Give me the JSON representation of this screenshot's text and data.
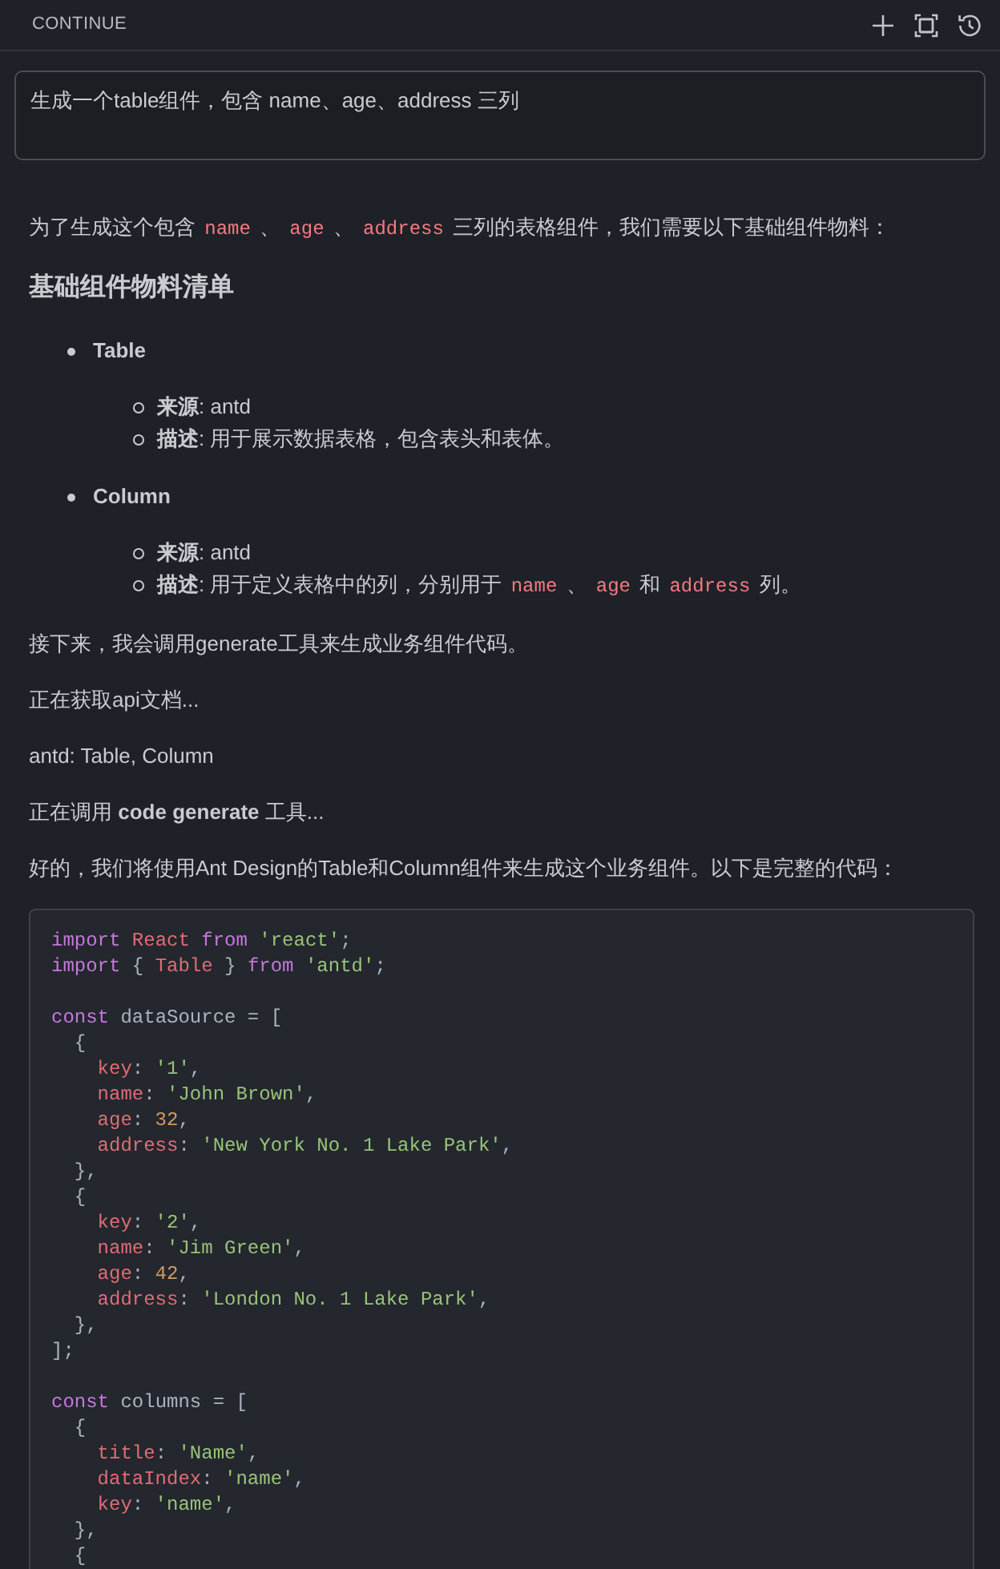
{
  "header": {
    "title": "CONTINUE"
  },
  "prompt": {
    "value": "生成一个table组件，包含 name、age、address 三列"
  },
  "message": [
    {
      "kind": "paragraph",
      "segments": [
        {
          "kind": "text",
          "text": "为了生成这个包含 "
        },
        {
          "kind": "code",
          "text": "name"
        },
        {
          "kind": "text",
          "text": " 、 "
        },
        {
          "kind": "code",
          "text": "age"
        },
        {
          "kind": "text",
          "text": " 、 "
        },
        {
          "kind": "code",
          "text": "address"
        },
        {
          "kind": "text",
          "text": " 三列的表格组件，我们需要以下基础组件物料："
        }
      ]
    },
    {
      "kind": "heading",
      "text": "基础组件物料清单"
    },
    {
      "kind": "list",
      "items": [
        {
          "text": "Table",
          "children": [
            {
              "segments": [
                {
                  "kind": "text",
                  "text": "**来源**: antd"
                }
              ]
            },
            {
              "segments": [
                {
                  "kind": "text",
                  "text": "**描述**: 用于展示数据表格，包含表头和表体。"
                }
              ]
            }
          ]
        },
        {
          "text": "Column",
          "children": [
            {
              "segments": [
                {
                  "kind": "text",
                  "text": "**来源**: antd"
                }
              ]
            },
            {
              "segments": [
                {
                  "kind": "text",
                  "text": "**描述**: 用于定义表格中的列，分别用于 "
                },
                {
                  "kind": "code",
                  "text": "name"
                },
                {
                  "kind": "text",
                  "text": " 、 "
                },
                {
                  "kind": "code",
                  "text": "age"
                },
                {
                  "kind": "text",
                  "text": " 和 "
                },
                {
                  "kind": "code",
                  "text": "address"
                },
                {
                  "kind": "text",
                  "text": " 列。"
                }
              ]
            }
          ]
        }
      ]
    },
    {
      "kind": "paragraph",
      "segments": [
        {
          "kind": "text",
          "text": "接下来，我会调用generate工具来生成业务组件代码。"
        }
      ]
    },
    {
      "kind": "paragraph",
      "segments": [
        {
          "kind": "text",
          "text": "正在获取api文档..."
        }
      ]
    },
    {
      "kind": "paragraph",
      "segments": [
        {
          "kind": "text",
          "text": "antd: Table, Column"
        }
      ]
    },
    {
      "kind": "paragraph",
      "segments": [
        {
          "kind": "text",
          "text": "正在调用 **code generate** 工具..."
        }
      ]
    },
    {
      "kind": "paragraph",
      "segments": [
        {
          "kind": "text",
          "text": "好的，我们将使用Ant Design的Table和Column组件来生成这个业务组件。以下是完整的代码："
        }
      ]
    },
    {
      "kind": "code",
      "groups": [
        [
          {
            "tokens": [
              {
                "kind": "keyword",
                "text": "import"
              },
              {
                "kind": "name",
                "text": " React"
              },
              {
                "kind": "keyword",
                "text": " from"
              },
              {
                "kind": "string",
                "text": " 'react'"
              },
              {
                "kind": "plain",
                "text": ";"
              }
            ]
          },
          {
            "tokens": [
              {
                "kind": "keyword",
                "text": "import"
              },
              {
                "kind": "plain",
                "text": " { "
              },
              {
                "kind": "name",
                "text": "Table"
              },
              {
                "kind": "plain",
                "text": " } "
              },
              {
                "kind": "keyword",
                "text": "from"
              },
              {
                "kind": "string",
                "text": " 'antd'"
              },
              {
                "kind": "plain",
                "text": ";"
              }
            ]
          }
        ],
        [
          {
            "tokens": [
              {
                "kind": "keyword",
                "text": "const"
              },
              {
                "kind": "plain",
                "text": " dataSource = ["
              }
            ],
            "children": [
              {
                "tokens": [
                  {
                    "kind": "plain",
                    "text": "{"
                  }
                ],
                "children": [
                  {
                    "tokens": [
                      {
                        "kind": "name",
                        "text": "key"
                      },
                      {
                        "kind": "plain",
                        "text": ":"
                      },
                      {
                        "kind": "string",
                        "text": " '1'"
                      },
                      {
                        "kind": "plain",
                        "text": ","
                      }
                    ]
                  },
                  {
                    "tokens": [
                      {
                        "kind": "name",
                        "text": "name"
                      },
                      {
                        "kind": "plain",
                        "text": ":"
                      },
                      {
                        "kind": "string",
                        "text": " 'John Brown'"
                      },
                      {
                        "kind": "plain",
                        "text": ","
                      }
                    ]
                  },
                  {
                    "tokens": [
                      {
                        "kind": "name",
                        "text": "age"
                      },
                      {
                        "kind": "plain",
                        "text": ":"
                      },
                      {
                        "kind": "number",
                        "text": " 32"
                      },
                      {
                        "kind": "plain",
                        "text": ","
                      }
                    ]
                  },
                  {
                    "tokens": [
                      {
                        "kind": "name",
                        "text": "address"
                      },
                      {
                        "kind": "plain",
                        "text": ":"
                      },
                      {
                        "kind": "string",
                        "text": " 'New York No. 1 Lake Park'"
                      },
                      {
                        "kind": "plain",
                        "text": ","
                      }
                    ]
                  }
                ]
              },
              {
                "tokens": [
                  {
                    "kind": "plain",
                    "text": "},"
                  }
                ]
              },
              {
                "tokens": [
                  {
                    "kind": "plain",
                    "text": "{"
                  }
                ],
                "children": [
                  {
                    "tokens": [
                      {
                        "kind": "name",
                        "text": "key"
                      },
                      {
                        "kind": "plain",
                        "text": ":"
                      },
                      {
                        "kind": "string",
                        "text": " '2'"
                      },
                      {
                        "kind": "plain",
                        "text": ","
                      }
                    ]
                  },
                  {
                    "tokens": [
                      {
                        "kind": "name",
                        "text": "name"
                      },
                      {
                        "kind": "plain",
                        "text": ":"
                      },
                      {
                        "kind": "string",
                        "text": " 'Jim Green'"
                      },
                      {
                        "kind": "plain",
                        "text": ","
                      }
                    ]
                  },
                  {
                    "tokens": [
                      {
                        "kind": "name",
                        "text": "age"
                      },
                      {
                        "kind": "plain",
                        "text": ":"
                      },
                      {
                        "kind": "number",
                        "text": " 42"
                      },
                      {
                        "kind": "plain",
                        "text": ","
                      }
                    ]
                  },
                  {
                    "tokens": [
                      {
                        "kind": "name",
                        "text": "address"
                      },
                      {
                        "kind": "plain",
                        "text": ":"
                      },
                      {
                        "kind": "string",
                        "text": " 'London No. 1 Lake Park'"
                      },
                      {
                        "kind": "plain",
                        "text": ","
                      }
                    ]
                  }
                ]
              },
              {
                "tokens": [
                  {
                    "kind": "plain",
                    "text": "},"
                  }
                ]
              }
            ]
          },
          {
            "tokens": [
              {
                "kind": "plain",
                "text": "];"
              }
            ]
          }
        ],
        [
          {
            "tokens": [
              {
                "kind": "keyword",
                "text": "const"
              },
              {
                "kind": "plain",
                "text": " columns = ["
              }
            ],
            "children": [
              {
                "tokens": [
                  {
                    "kind": "plain",
                    "text": "{"
                  }
                ],
                "children": [
                  {
                    "tokens": [
                      {
                        "kind": "name",
                        "text": "title"
                      },
                      {
                        "kind": "plain",
                        "text": ":"
                      },
                      {
                        "kind": "string",
                        "text": " 'Name'"
                      },
                      {
                        "kind": "plain",
                        "text": ","
                      }
                    ]
                  },
                  {
                    "tokens": [
                      {
                        "kind": "name",
                        "text": "dataIndex"
                      },
                      {
                        "kind": "plain",
                        "text": ":"
                      },
                      {
                        "kind": "string",
                        "text": " 'name'"
                      },
                      {
                        "kind": "plain",
                        "text": ","
                      }
                    ]
                  },
                  {
                    "tokens": [
                      {
                        "kind": "name",
                        "text": "key"
                      },
                      {
                        "kind": "plain",
                        "text": ":"
                      },
                      {
                        "kind": "string",
                        "text": " 'name'"
                      },
                      {
                        "kind": "plain",
                        "text": ","
                      }
                    ]
                  }
                ]
              },
              {
                "tokens": [
                  {
                    "kind": "plain",
                    "text": "},"
                  }
                ]
              },
              {
                "tokens": [
                  {
                    "kind": "plain",
                    "text": "{"
                  }
                ]
              }
            ]
          }
        ]
      ]
    }
  ]
}
